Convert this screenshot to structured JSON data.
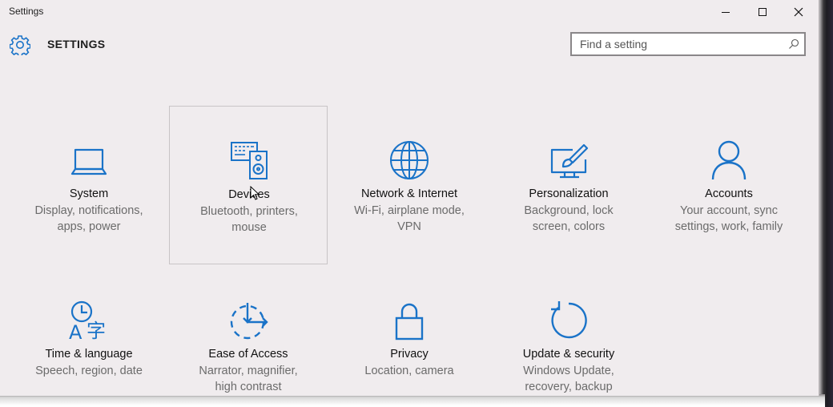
{
  "window": {
    "title": "Settings",
    "controls": {
      "minimize": "minimize-icon",
      "maximize": "maximize-icon",
      "close": "close-icon"
    }
  },
  "header": {
    "icon": "gear-icon",
    "title": "SETTINGS",
    "search_placeholder": "Find a setting",
    "search_value": ""
  },
  "colors": {
    "accent": "#1a73c8",
    "background": "#f0ecee",
    "description": "#6b6b6b"
  },
  "categories": [
    {
      "icon": "laptop-icon",
      "label": "System",
      "desc1": "Display, notifications,",
      "desc2": "apps, power"
    },
    {
      "icon": "devices-icon",
      "label": "Devices",
      "desc1": "Bluetooth, printers,",
      "desc2": "mouse",
      "selected": true
    },
    {
      "icon": "globe-icon",
      "label": "Network & Internet",
      "desc1": "Wi-Fi, airplane mode,",
      "desc2": "VPN"
    },
    {
      "icon": "personalization-icon",
      "label": "Personalization",
      "desc1": "Background, lock",
      "desc2": "screen, colors"
    },
    {
      "icon": "person-icon",
      "label": "Accounts",
      "desc1": "Your account, sync",
      "desc2": "settings, work, family"
    },
    {
      "icon": "time-language-icon",
      "label": "Time & language",
      "desc1": "Speech, region, date",
      "desc2": ""
    },
    {
      "icon": "ease-of-access-icon",
      "label": "Ease of Access",
      "desc1": "Narrator, magnifier,",
      "desc2": "high contrast"
    },
    {
      "icon": "lock-icon",
      "label": "Privacy",
      "desc1": "Location, camera",
      "desc2": ""
    },
    {
      "icon": "refresh-icon",
      "label": "Update & security",
      "desc1": "Windows Update,",
      "desc2": "recovery, backup"
    }
  ]
}
